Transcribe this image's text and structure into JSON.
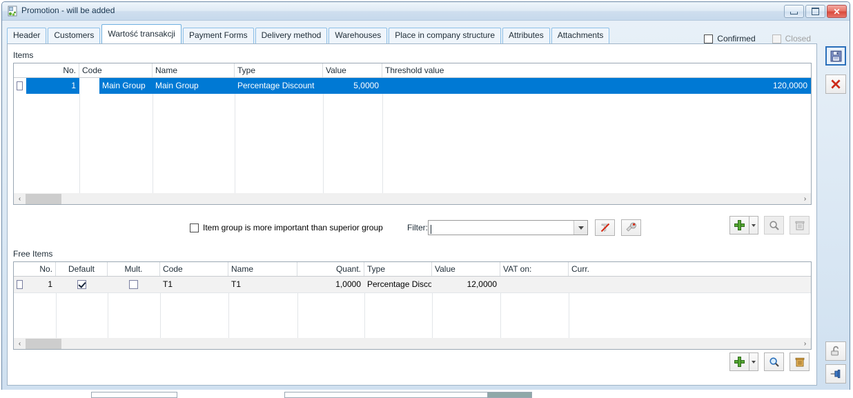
{
  "window": {
    "title": "Promotion - will be added",
    "icon": "promotion-window-icon",
    "minimize_label": "",
    "maximize_label": "",
    "close_label": "✕"
  },
  "tabs": [
    {
      "label": "Header",
      "active": false
    },
    {
      "label": "Customers",
      "active": false
    },
    {
      "label": "Wartość transakcji",
      "active": true
    },
    {
      "label": "Payment Forms",
      "active": false
    },
    {
      "label": "Delivery method",
      "active": false
    },
    {
      "label": "Warehouses",
      "active": false
    },
    {
      "label": "Place in company structure",
      "active": false
    },
    {
      "label": "Attributes",
      "active": false
    },
    {
      "label": "Attachments",
      "active": false
    }
  ],
  "status_checks": {
    "confirmed_label": "Confirmed",
    "confirmed_checked": false,
    "closed_label": "Closed",
    "closed_checked": false,
    "closed_disabled": true
  },
  "items_panel": {
    "label": "Items",
    "columns": [
      "No.",
      "Code",
      "Name",
      "Type",
      "Value",
      "Threshold value"
    ],
    "rows": [
      {
        "selected": true,
        "checked": false,
        "no": "1",
        "code": "Main Group",
        "name": "Main Group",
        "type": "Percentage Discount",
        "value": "5,0000",
        "threshold": "120,0000"
      }
    ],
    "scroll_left_label": "‹",
    "scroll_right_label": "›"
  },
  "options_row": {
    "group_priority_label": "Item group is more important than superior group",
    "group_priority_checked": false,
    "filter_label": "Filter:",
    "filter_value": "",
    "filter_placeholder": "",
    "clear_filter_icon": "clear-filter-icon",
    "filter_builder_icon": "filter-construct-icon"
  },
  "items_toolbar": {
    "add_icon": "add-plus-icon",
    "add_dropdown_icon": "chevron-down-icon",
    "search_icon": "magnifier-icon",
    "delete_icon": "trash-icon",
    "add_enabled": true,
    "search_enabled": false,
    "delete_enabled": false
  },
  "free_items_panel": {
    "label": "Free Items",
    "columns": [
      "No.",
      "Default",
      "Mult.",
      "Code",
      "Name",
      "Quant.",
      "Type",
      "Value",
      "VAT on:",
      "Curr."
    ],
    "rows": [
      {
        "selected": false,
        "checked": false,
        "no": "1",
        "default": true,
        "mult": false,
        "code": "T1",
        "name": "T1",
        "quant": "1,0000",
        "type": "Percentage Disco",
        "value": "12,0000",
        "vat_on": "",
        "curr": ""
      }
    ],
    "scroll_left_label": "‹",
    "scroll_right_label": "›"
  },
  "free_items_toolbar": {
    "add_icon": "add-plus-icon",
    "add_dropdown_icon": "chevron-down-icon",
    "search_icon": "magnifier-icon",
    "delete_icon": "trash-icon",
    "add_enabled": true,
    "search_enabled": true,
    "delete_enabled": true
  },
  "side_toolbar": {
    "save_icon": "save-diskette-icon",
    "cancel_icon": "close-x-icon",
    "lock_icon": "padlock-open-icon",
    "pin_icon": "pin-icon"
  },
  "colors": {
    "selection": "#0079d4",
    "accent_border": "#6fb0e0",
    "window_frame": "#6d8aa8"
  }
}
